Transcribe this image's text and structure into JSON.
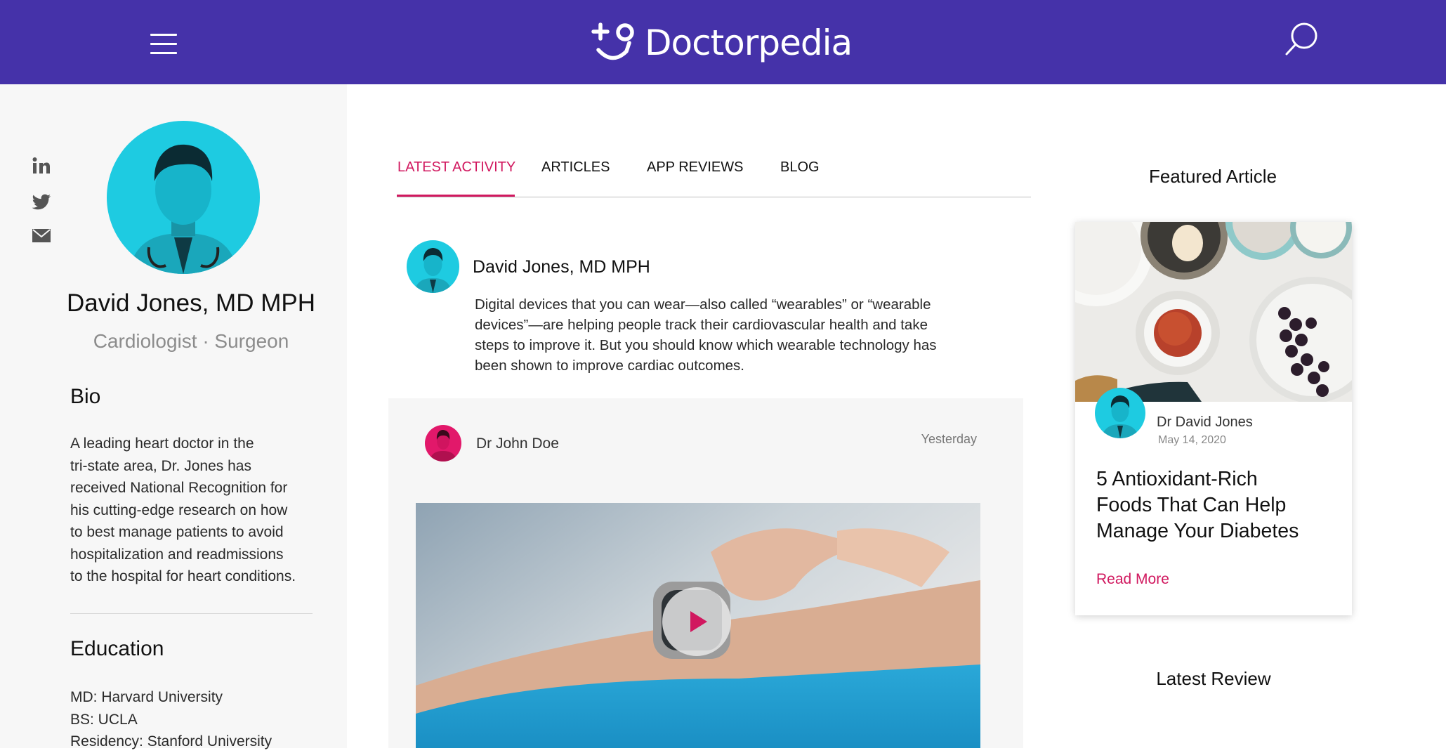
{
  "header": {
    "brand_name": "Doctorpedia",
    "bg_color": "#4532a9"
  },
  "profile": {
    "name": "David Jones, MD MPH",
    "role": "Cardiologist · Surgeon",
    "bio_heading": "Bio",
    "bio_lines": [
      "A leading heart doctor in the",
      "tri-state area, Dr. Jones has",
      "received National Recognition for",
      "his cutting-edge research on how",
      "to best manage patients to avoid",
      "hospitalization and readmissions",
      "to the hospital for heart conditions."
    ],
    "education_heading": "Education",
    "education": [
      "MD: Harvard University",
      "BS: UCLA",
      "Residency: Stanford University"
    ],
    "social_icons": [
      "linkedin-icon",
      "twitter-icon",
      "email-icon"
    ]
  },
  "tabs": [
    {
      "label": "LATEST ACTIVITY",
      "active": true
    },
    {
      "label": "ARTICLES",
      "active": false
    },
    {
      "label": "APP REVIEWS",
      "active": false
    },
    {
      "label": "BLOG",
      "active": false
    }
  ],
  "activity": {
    "post1": {
      "author": "David Jones, MD MPH",
      "lines": [
        "Digital devices that you can wear—also called “wearables” or “wearable",
        "devices”—are helping people track their cardiovascular health and take",
        "steps to improve it. But you should know which wearable technology has",
        "been shown to improve cardiac outcomes."
      ]
    },
    "post2": {
      "author": "Dr John Doe",
      "time": "Yesterday"
    }
  },
  "featured": {
    "heading": "Featured Article",
    "author": "Dr David Jones",
    "date": "May 14, 2020",
    "headline_lines": [
      "5 Antioxidant-Rich",
      "Foods That Can Help",
      "Manage Your Diabetes"
    ],
    "read_more": "Read More"
  },
  "latest_review": {
    "heading": "Latest Review"
  },
  "colors": {
    "accent": "#d1185f",
    "avatar_cyan": "#1ecbe1",
    "avatar_pink": "#e2186a"
  }
}
